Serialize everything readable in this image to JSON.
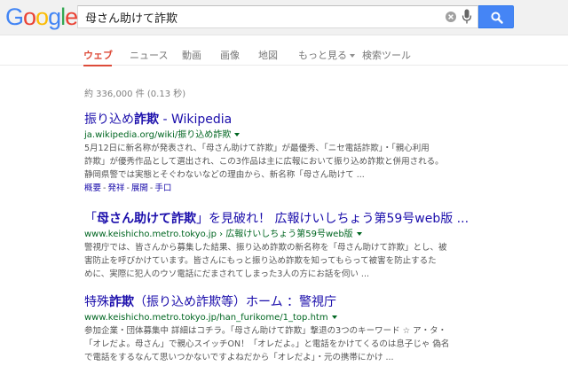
{
  "header": {
    "logo_letters": [
      {
        "ch": "G",
        "color": "#4285f4"
      },
      {
        "ch": "o",
        "color": "#ea4335"
      },
      {
        "ch": "o",
        "color": "#fbbc05"
      },
      {
        "ch": "g",
        "color": "#4285f4"
      },
      {
        "ch": "l",
        "color": "#34a853"
      },
      {
        "ch": "e",
        "color": "#ea4335"
      }
    ],
    "query": "母さん助けて詐欺"
  },
  "tabs": {
    "web": "ウェブ",
    "news": "ニュース",
    "video": "動画",
    "images": "画像",
    "maps": "地図",
    "more": "もっと見る",
    "tools": "検索ツール"
  },
  "stats": "約 336,000 件 (0.13 秒)",
  "results": [
    {
      "title_pre": "振り込め",
      "title_bold": "詐欺",
      "title_post": " - Wikipedia",
      "url": "ja.wikipedia.org/wiki/振り込め詐欺",
      "snippet": [
        "5月12日に新名称が発表され、「母さん助けて詐欺」が最優秀、「ニセ電話詐欺」・「親心利用",
        "詐欺」が優秀作品として選出され、この3作品は主に広報において振り込め詐欺と併用される。",
        "静岡県警では実態とそぐわないなどの理由から、新名称「母さん助けて ..."
      ],
      "links": [
        "概要",
        "発祥",
        "展開",
        "手口"
      ]
    },
    {
      "title_pre": "「",
      "title_bold": "母さん助けて詐欺",
      "title_post": "」を見破れ！ 広報けいしちょう第59号web版 ...",
      "url": "www.keishicho.metro.tokyo.jp › 広報けいしちょう第59号web版",
      "snippet": [
        "警視庁では、皆さんから募集した結果、振り込め詐欺の新名称を「母さん助けて詐欺」とし、被",
        "害防止を呼びかけています。皆さんにもっと振り込め詐欺を知ってもらって被害を防止するた",
        "めに、実際に犯人のウソ電話にだまされてしまった3人の方にお話を伺い ..."
      ]
    },
    {
      "title_pre": "特殊",
      "title_bold": "詐欺",
      "title_post": "（振り込め詐欺等）ホーム ：警視庁",
      "url": "www.keishicho.metro.tokyo.jp/han_furikome/1_top.htm",
      "snippet": [
        "参加企業・団体募集中 詳細はコチラ。「母さん助けて詐欺」撃退の3つのキーワード ☆ ア・タ・",
        "「オレだよ。母さん」で親心スイッチON！「オレだよ。」と電話をかけてくるのは息子じゃ 偽名",
        "で電話をするなんて思いつかないですよねだから「オレだよ」・元の携帯にかけ ..."
      ]
    }
  ]
}
